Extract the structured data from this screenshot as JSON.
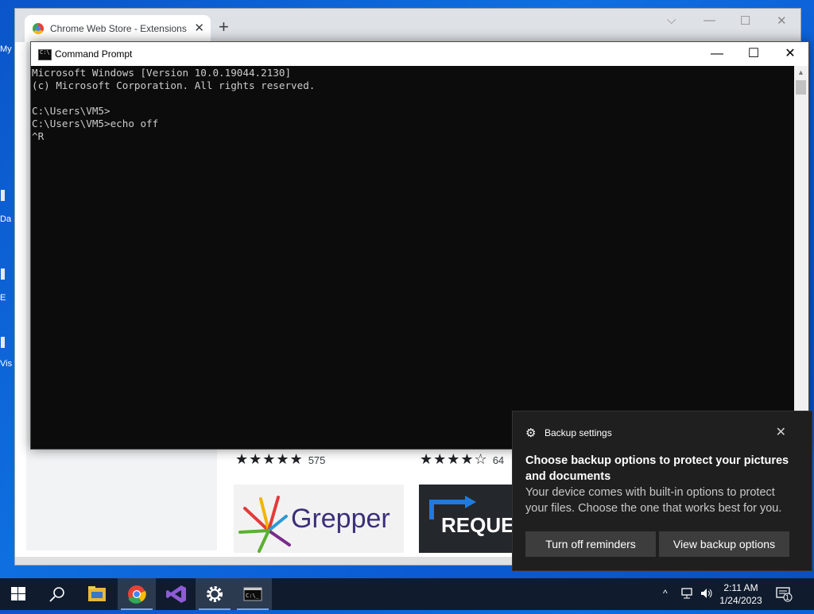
{
  "desktop": {
    "icons": [
      {
        "label": "My",
        "icon": "folder-icon"
      },
      {
        "label": "Da",
        "icon": "file-icon"
      },
      {
        "label": "E",
        "icon": "file-icon"
      },
      {
        "label": "Vis",
        "icon": "file-icon"
      }
    ]
  },
  "chrome": {
    "tab_title": "Chrome Web Store - Extensions",
    "tab_close": "✕",
    "new_tab": "+",
    "controls": {
      "dropdown": "⌵",
      "minimize": "—",
      "maximize": "☐",
      "close": "✕"
    },
    "ratings": [
      {
        "stars": "★★★★★",
        "count": "575"
      },
      {
        "stars": "★★★★☆",
        "count": "64"
      }
    ],
    "cards": {
      "grepper": "Grepper",
      "request": "REQUE"
    }
  },
  "cmd": {
    "title": "Command Prompt",
    "controls": {
      "minimize": "—",
      "maximize": "☐",
      "close": "✕"
    },
    "output": "Microsoft Windows [Version 10.0.19044.2130]\n(c) Microsoft Corporation. All rights reserved.\n\nC:\\Users\\VM5>\nC:\\Users\\VM5>echo off\n^R"
  },
  "toast": {
    "app_name": "Backup settings",
    "close": "✕",
    "heading": "Choose backup options to protect your pictures and documents",
    "body": "Your device comes with built-in options to protect your files. Choose the one that works best for you.",
    "button_1": "Turn off reminders",
    "button_2": "View backup options"
  },
  "taskbar": {
    "apps": [
      "start-icon",
      "search-icon",
      "file-explorer-icon",
      "chrome-icon",
      "visual-studio-icon",
      "settings-icon",
      "command-prompt-icon"
    ],
    "tray": {
      "chevron": "^"
    },
    "time": "2:11 AM",
    "date": "1/24/2023",
    "notification_count": "1"
  },
  "colors": {
    "desktop_blue": "#0f6fe0",
    "taskbar": "#101c2e",
    "toast_bg": "#1f1f1f",
    "console_bg": "#0c0c0c",
    "console_text": "#cccccc"
  }
}
